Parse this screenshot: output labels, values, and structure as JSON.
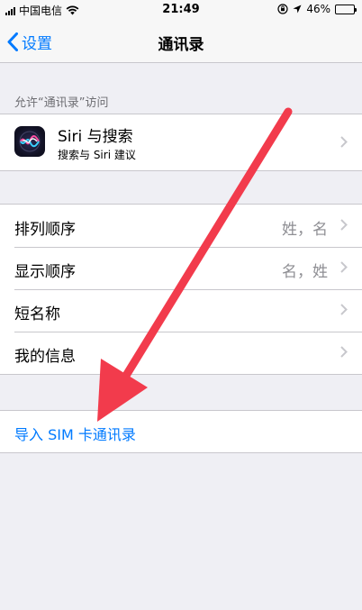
{
  "status_bar": {
    "carrier": "中国电信",
    "time": "21:49",
    "battery": "46%",
    "battery_level": 0.46
  },
  "nav": {
    "back_label": "设置",
    "title": "通讯录"
  },
  "access_section": {
    "header": "允许“通讯录”访问",
    "siri": {
      "title": "Siri 与搜索",
      "subtitle": "搜索与 Siri 建议"
    }
  },
  "settings": {
    "items": [
      {
        "label": "排列顺序",
        "value": "姓，名"
      },
      {
        "label": "显示顺序",
        "value": "名，姓"
      },
      {
        "label": "短名称",
        "value": ""
      },
      {
        "label": "我的信息",
        "value": ""
      }
    ]
  },
  "import": {
    "label": "导入 SIM 卡通讯录"
  },
  "colors": {
    "accent": "#007aff",
    "annotation_arrow": "#f23b4c"
  }
}
